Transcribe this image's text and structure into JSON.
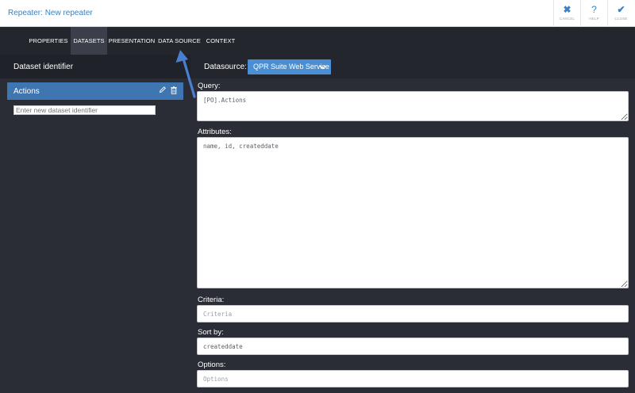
{
  "header": {
    "title": "Repeater: New repeater",
    "buttons": [
      {
        "label": "CANCEL",
        "icon": "close-icon",
        "glyph": "✖"
      },
      {
        "label": "HELP",
        "icon": "help-icon",
        "glyph": "?"
      },
      {
        "label": "CLOSE",
        "icon": "check-icon",
        "glyph": "✔"
      }
    ]
  },
  "tabs": [
    {
      "label": "PROPERTIES",
      "active": false
    },
    {
      "label": "DATASETS",
      "active": true
    },
    {
      "label": "PRESENTATION",
      "active": false
    },
    {
      "label": "DATA SOURCE",
      "active": false
    },
    {
      "label": "CONTEXT",
      "active": false
    }
  ],
  "left": {
    "title": "Dataset identifier",
    "item": {
      "label": "Actions"
    },
    "new_placeholder": "Enter new dataset identifier"
  },
  "datasource": {
    "label": "Datasource:",
    "value": "QPR Suite Web Service"
  },
  "form": {
    "query": {
      "label": "Query:",
      "value": "[PO].Actions"
    },
    "attributes": {
      "label": "Attributes:",
      "value": "name, id, createddate"
    },
    "criteria": {
      "label": "Criteria:",
      "value": "",
      "placeholder": "Criteria"
    },
    "sortby": {
      "label": "Sort by:",
      "value": "createddate",
      "placeholder": ""
    },
    "options": {
      "label": "Options:",
      "value": "",
      "placeholder": "Options"
    }
  },
  "colors": {
    "accent": "#3b82c4",
    "selected_item": "#3f76b1",
    "select_button": "#4a8fd3",
    "background": "#2a2d35",
    "arrow": "#4a7fd0"
  }
}
